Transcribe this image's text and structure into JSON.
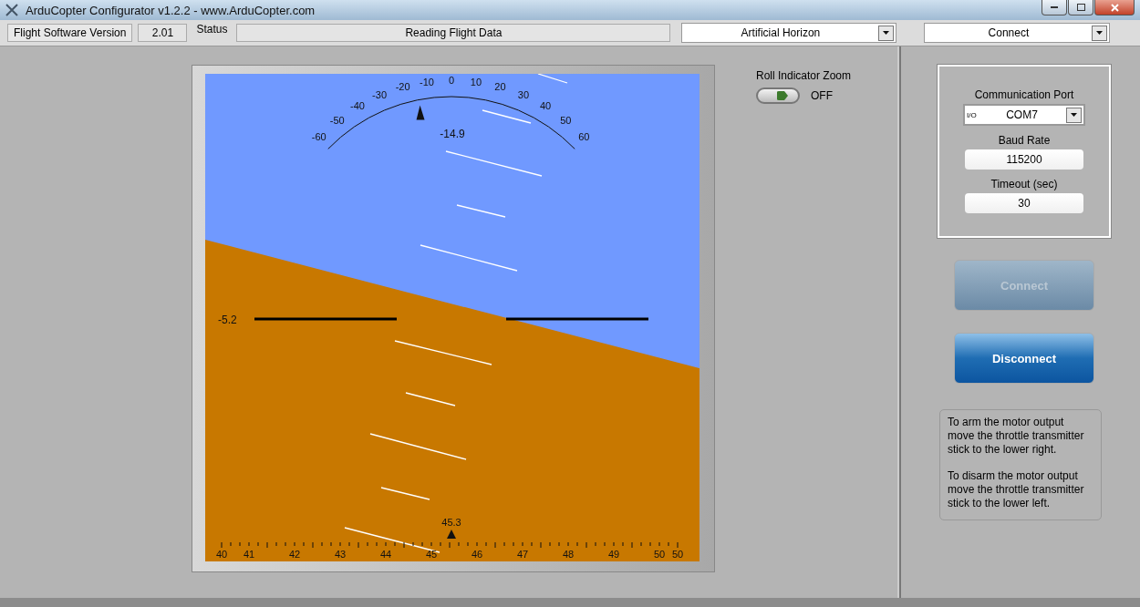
{
  "window": {
    "title": "ArduCopter Configurator v1.2.2 - www.ArduCopter.com"
  },
  "top_bar": {
    "version_label": "Flight Software Version",
    "version_value": "2.01",
    "status_label": "Status",
    "status_value": "Reading Flight Data",
    "view_select": "Artificial Horizon",
    "mode_select": "Connect"
  },
  "horizon": {
    "roll_scale": [
      "-60",
      "-50",
      "-40",
      "-30",
      "-20",
      "-10",
      "0",
      "10",
      "20",
      "30",
      "40",
      "50",
      "60"
    ],
    "roll_reading": "-14.9",
    "pitch_reading": "-5.2",
    "heading_scale": [
      "40",
      "41",
      "42",
      "43",
      "44",
      "45",
      "46",
      "47",
      "48",
      "49",
      "50",
      "50"
    ],
    "heading_reading": "45.3"
  },
  "roll_zoom": {
    "label": "Roll Indicator Zoom",
    "on": false,
    "state_text": "OFF"
  },
  "connection": {
    "port_label": "Communication Port",
    "port_prefix": "I/O",
    "port_value": "COM7",
    "baud_label": "Baud Rate",
    "baud_value": "115200",
    "timeout_label": "Timeout (sec)",
    "timeout_value": "30"
  },
  "buttons": [
    {
      "label": "Connect",
      "disabled": true
    },
    {
      "label": "Disconnect",
      "disabled": false
    }
  ],
  "info": [
    "To arm the motor output move the throttle transmitter stick to the lower right.",
    "To disarm the motor output move the throttle transmitter stick to the lower left."
  ]
}
